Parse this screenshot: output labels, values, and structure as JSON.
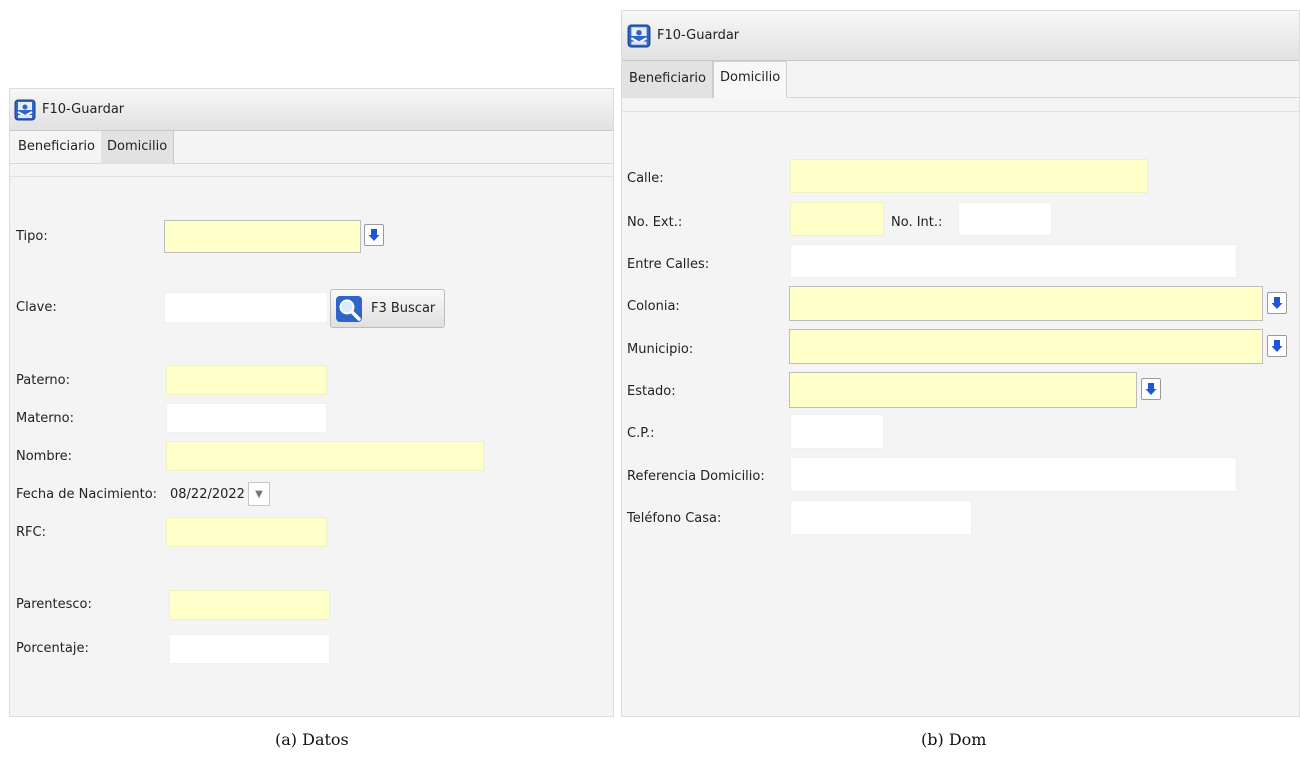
{
  "toolbar": {
    "save_label": "F10-Guardar"
  },
  "tabs": {
    "beneficiario": "Beneficiario",
    "domicilio": "Domicilio"
  },
  "datos": {
    "tipo_label": "Tipo:",
    "clave_label": "Clave:",
    "buscar_label": "F3 Buscar",
    "paterno_label": "Paterno:",
    "materno_label": "Materno:",
    "nombre_label": "Nombre:",
    "fecha_label": "Fecha de Nacimiento:",
    "fecha_value": "08/22/2022",
    "rfc_label": "RFC:",
    "parentesco_label": "Parentesco:",
    "porcentaje_label": "Porcentaje:"
  },
  "dom": {
    "calle_label": "Calle:",
    "noext_label": "No. Ext.:",
    "noint_label": "No. Int.:",
    "entre_label": "Entre Calles:",
    "colonia_label": "Colonia:",
    "municipio_label": "Municipio:",
    "estado_label": "Estado:",
    "cp_label": "C.P.:",
    "referencia_label": "Referencia Domicilio:",
    "telefono_label": "Teléfono Casa:"
  },
  "captions": {
    "a": "(a)  Datos",
    "b": "(b)  Dom"
  },
  "colors": {
    "required_field": "#ffffc9",
    "arrow_blue": "#1f55d8"
  },
  "icons": [
    "save-icon",
    "down-arrow-icon",
    "search-icon",
    "dropdown-triangle-icon"
  ]
}
